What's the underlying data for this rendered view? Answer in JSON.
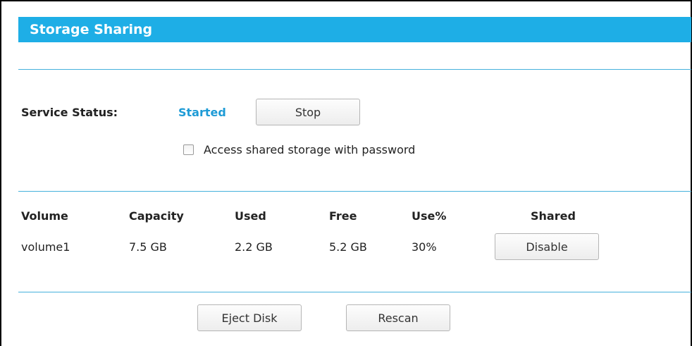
{
  "page": {
    "title": "Storage Sharing"
  },
  "service": {
    "status_label": "Service Status:",
    "status_value": "Started",
    "stop_button": "Stop",
    "password_checkbox_label": "Access shared storage with password",
    "password_checked": false
  },
  "table": {
    "headers": {
      "volume": "Volume",
      "capacity": "Capacity",
      "used": "Used",
      "free": "Free",
      "use_percent": "Use%",
      "shared": "Shared"
    },
    "rows": [
      {
        "volume": "volume1",
        "capacity": "7.5 GB",
        "used": "2.2 GB",
        "free": "5.2 GB",
        "use_percent": "30%",
        "shared_button": "Disable"
      }
    ]
  },
  "actions": {
    "eject_button": "Eject Disk",
    "rescan_button": "Rescan"
  },
  "colors": {
    "title_bar": "#1eaee6",
    "divider": "#45b1dc",
    "status_value": "#1e9bd6"
  }
}
